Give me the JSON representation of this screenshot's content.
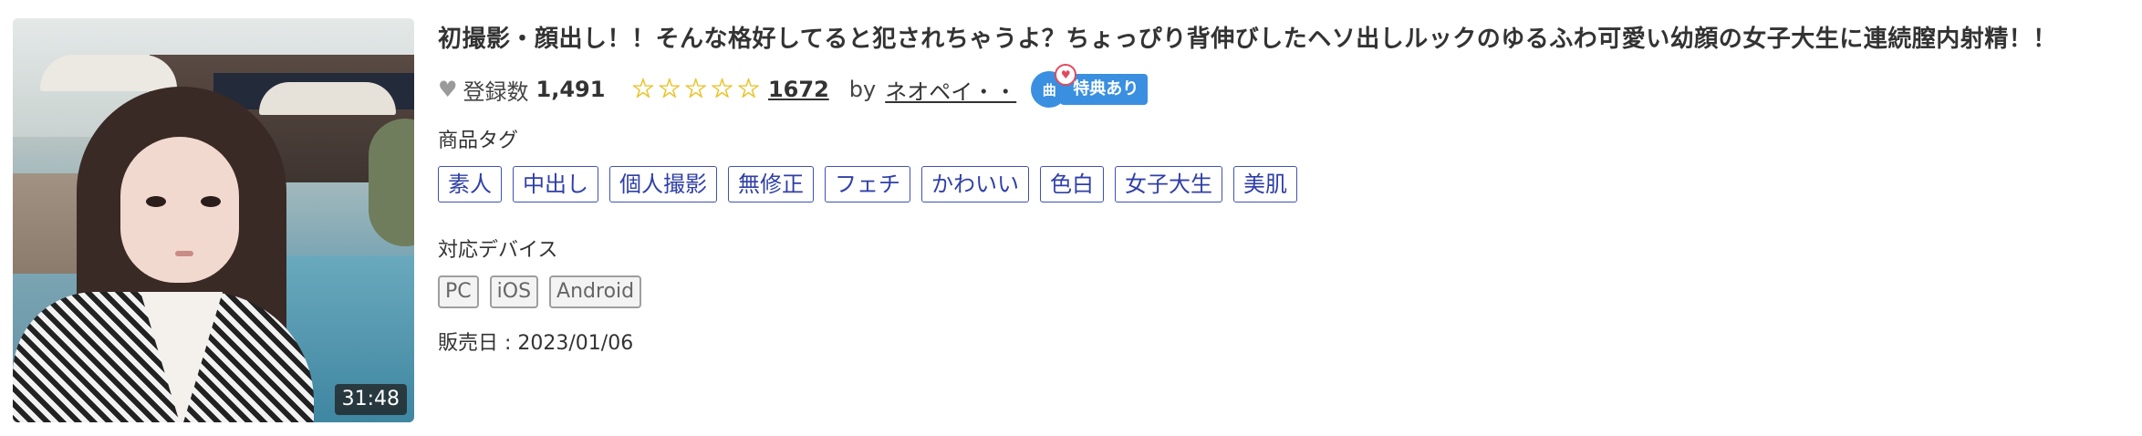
{
  "thumbnail": {
    "duration": "31:48"
  },
  "title": "初撮影・顔出し！！そんな格好してると犯されちゃうよ？ちょっぴり背伸びしたヘソ出しルックのゆるふわ可愛い幼顔の女子大生に連続膣内射精！！",
  "meta": {
    "heart_icon": "heart-icon",
    "registered_label": "登録数",
    "registered_count": "1,491",
    "rating_stars": 5,
    "review_count": "1672",
    "by_label": "by",
    "seller": "ネオペイ・・",
    "badge_icon_text": "曲",
    "badge_label": "特典あり"
  },
  "tags_label": "商品タグ",
  "tags": [
    "素人",
    "中出し",
    "個人撮影",
    "無修正",
    "フェチ",
    "かわいい",
    "色白",
    "女子大生",
    "美肌"
  ],
  "devices_label": "対応デバイス",
  "devices": [
    "PC",
    "iOS",
    "Android"
  ],
  "release": "販売日 : 2023/01/06",
  "colors": {
    "tag_border": "#3f51b5",
    "star": "#f2c400",
    "badge": "#3a8fe0"
  }
}
